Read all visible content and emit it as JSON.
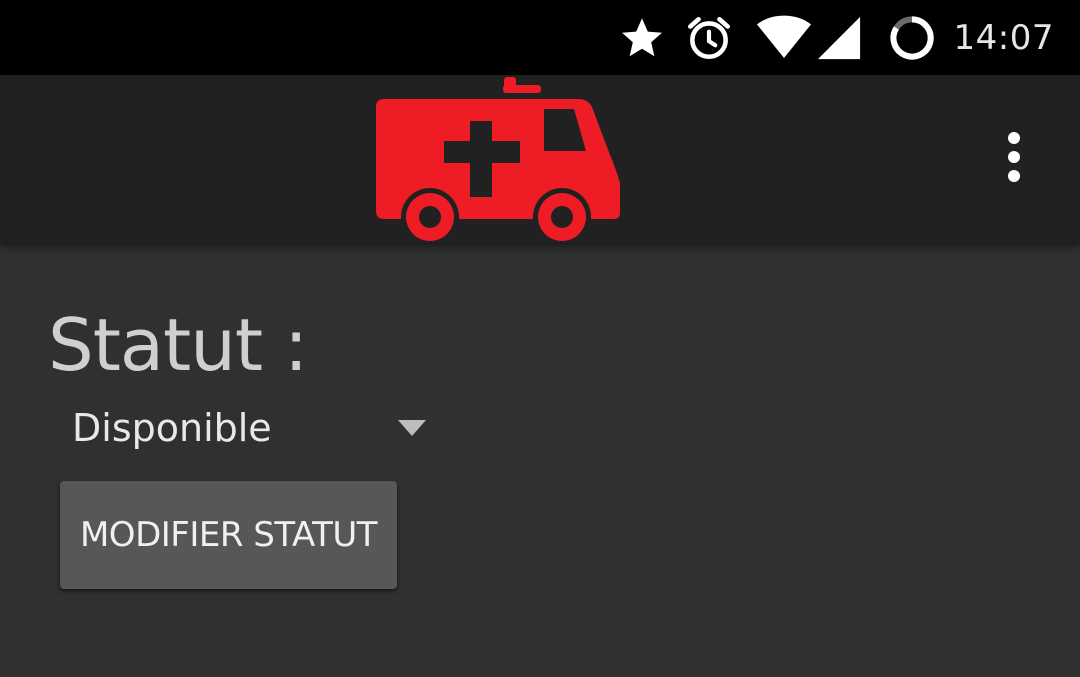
{
  "status_bar": {
    "icons": [
      "star-icon",
      "alarm-icon",
      "wifi-icon",
      "cell-signal-icon",
      "battery-icon"
    ],
    "time": "14:07"
  },
  "app_bar": {
    "logo_icon": "ambulance-icon",
    "menu_icon": "more-vert-icon"
  },
  "main": {
    "status_label": "Statut :",
    "status_spinner": {
      "selected": "Disponible"
    },
    "modify_button_label": "MODIFIER STATUT"
  },
  "colors": {
    "status_bar_bg": "#000000",
    "app_bar_bg": "#212121",
    "content_bg": "#303030",
    "accent_red": "#ee1c25",
    "button_bg": "#575757"
  }
}
